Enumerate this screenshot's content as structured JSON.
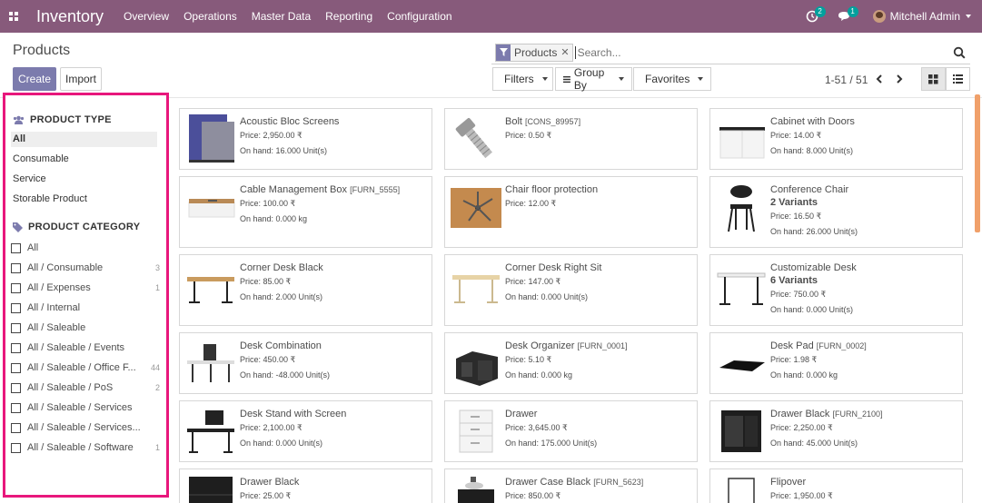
{
  "navbar": {
    "app_name": "Inventory",
    "menu": [
      "Overview",
      "Operations",
      "Master Data",
      "Reporting",
      "Configuration"
    ],
    "activity_count": "2",
    "messages_count": "1",
    "user_name": "Mitchell Admin"
  },
  "page": {
    "title": "Products",
    "create_label": "Create",
    "import_label": "Import"
  },
  "search": {
    "facet_label": "Products",
    "placeholder": "Search..."
  },
  "filters": {
    "filters_label": "Filters",
    "groupby_label": "Group By",
    "favorites_label": "Favorites"
  },
  "pager": {
    "text": "1-51 / 51"
  },
  "sidebar": {
    "type_header": "PRODUCT TYPE",
    "types": [
      "All",
      "Consumable",
      "Service",
      "Storable Product"
    ],
    "category_header": "PRODUCT CATEGORY",
    "categories": [
      {
        "label": "All",
        "count": ""
      },
      {
        "label": "All / Consumable",
        "count": "3"
      },
      {
        "label": "All / Expenses",
        "count": "1"
      },
      {
        "label": "All / Internal",
        "count": ""
      },
      {
        "label": "All / Saleable",
        "count": ""
      },
      {
        "label": "All / Saleable / Events",
        "count": ""
      },
      {
        "label": "All / Saleable / Office F...",
        "count": "44"
      },
      {
        "label": "All / Saleable / PoS",
        "count": "2"
      },
      {
        "label": "All / Saleable / Services",
        "count": ""
      },
      {
        "label": "All / Saleable / Services...",
        "count": ""
      },
      {
        "label": "All / Saleable / Software",
        "count": "1"
      }
    ]
  },
  "products": [
    {
      "name": "Acoustic Bloc Screens",
      "ref": "",
      "variants": "",
      "price": "Price: 2,950.00 ₹",
      "onhand": "On hand: 16.000 Unit(s)",
      "img": "screens"
    },
    {
      "name": "Bolt",
      "ref": "[CONS_89957]",
      "variants": "",
      "price": "Price: 0.50 ₹",
      "onhand": "",
      "img": "bolt"
    },
    {
      "name": "Cabinet with Doors",
      "ref": "",
      "variants": "",
      "price": "Price: 14.00 ₹",
      "onhand": "On hand: 8.000 Unit(s)",
      "img": "cabinet"
    },
    {
      "name": "Cable Management Box",
      "ref": "[FURN_5555]",
      "variants": "",
      "price": "Price: 100.00 ₹",
      "onhand": "On hand: 0.000 kg",
      "img": "cablebox"
    },
    {
      "name": "Chair floor protection",
      "ref": "",
      "variants": "",
      "price": "Price: 12.00 ₹",
      "onhand": "",
      "img": "floor"
    },
    {
      "name": "Conference Chair",
      "ref": "",
      "variants": "2 Variants",
      "price": "Price: 16.50 ₹",
      "onhand": "On hand: 26.000 Unit(s)",
      "img": "chair"
    },
    {
      "name": "Corner Desk Black",
      "ref": "",
      "variants": "",
      "price": "Price: 85.00 ₹",
      "onhand": "On hand: 2.000 Unit(s)",
      "img": "desk-wood"
    },
    {
      "name": "Corner Desk Right Sit",
      "ref": "",
      "variants": "",
      "price": "Price: 147.00 ₹",
      "onhand": "On hand: 0.000 Unit(s)",
      "img": "desk-light"
    },
    {
      "name": "Customizable Desk",
      "ref": "",
      "variants": "6 Variants",
      "price": "Price: 750.00 ₹",
      "onhand": "On hand: 0.000 Unit(s)",
      "img": "desk-white"
    },
    {
      "name": "Desk Combination",
      "ref": "",
      "variants": "",
      "price": "Price: 450.00 ₹",
      "onhand": "On hand: -48.000 Unit(s)",
      "img": "desk-combo"
    },
    {
      "name": "Desk Organizer",
      "ref": "[FURN_0001]",
      "variants": "",
      "price": "Price: 5.10 ₹",
      "onhand": "On hand: 0.000 kg",
      "img": "organizer"
    },
    {
      "name": "Desk Pad",
      "ref": "[FURN_0002]",
      "variants": "",
      "price": "Price: 1.98 ₹",
      "onhand": "On hand: 0.000 kg",
      "img": "pad"
    },
    {
      "name": "Desk Stand with Screen",
      "ref": "",
      "variants": "",
      "price": "Price: 2,100.00 ₹",
      "onhand": "On hand: 0.000 Unit(s)",
      "img": "desk-stand"
    },
    {
      "name": "Drawer",
      "ref": "",
      "variants": "",
      "price": "Price: 3,645.00 ₹",
      "onhand": "On hand: 175.000 Unit(s)",
      "img": "drawer-white"
    },
    {
      "name": "Drawer Black",
      "ref": "[FURN_2100]",
      "variants": "",
      "price": "Price: 2,250.00 ₹",
      "onhand": "On hand: 45.000 Unit(s)",
      "img": "drawer-black"
    },
    {
      "name": "Drawer Black",
      "ref": "",
      "variants": "",
      "price": "Price: 25.00 ₹",
      "onhand": "",
      "img": "drawer-black2"
    },
    {
      "name": "Drawer Case Black",
      "ref": "[FURN_5623]",
      "variants": "",
      "price": "Price: 850.00 ₹",
      "onhand": "",
      "img": "drawer-case"
    },
    {
      "name": "Flipover",
      "ref": "",
      "variants": "",
      "price": "Price: 1,950.00 ₹",
      "onhand": "",
      "img": "flipover"
    }
  ]
}
